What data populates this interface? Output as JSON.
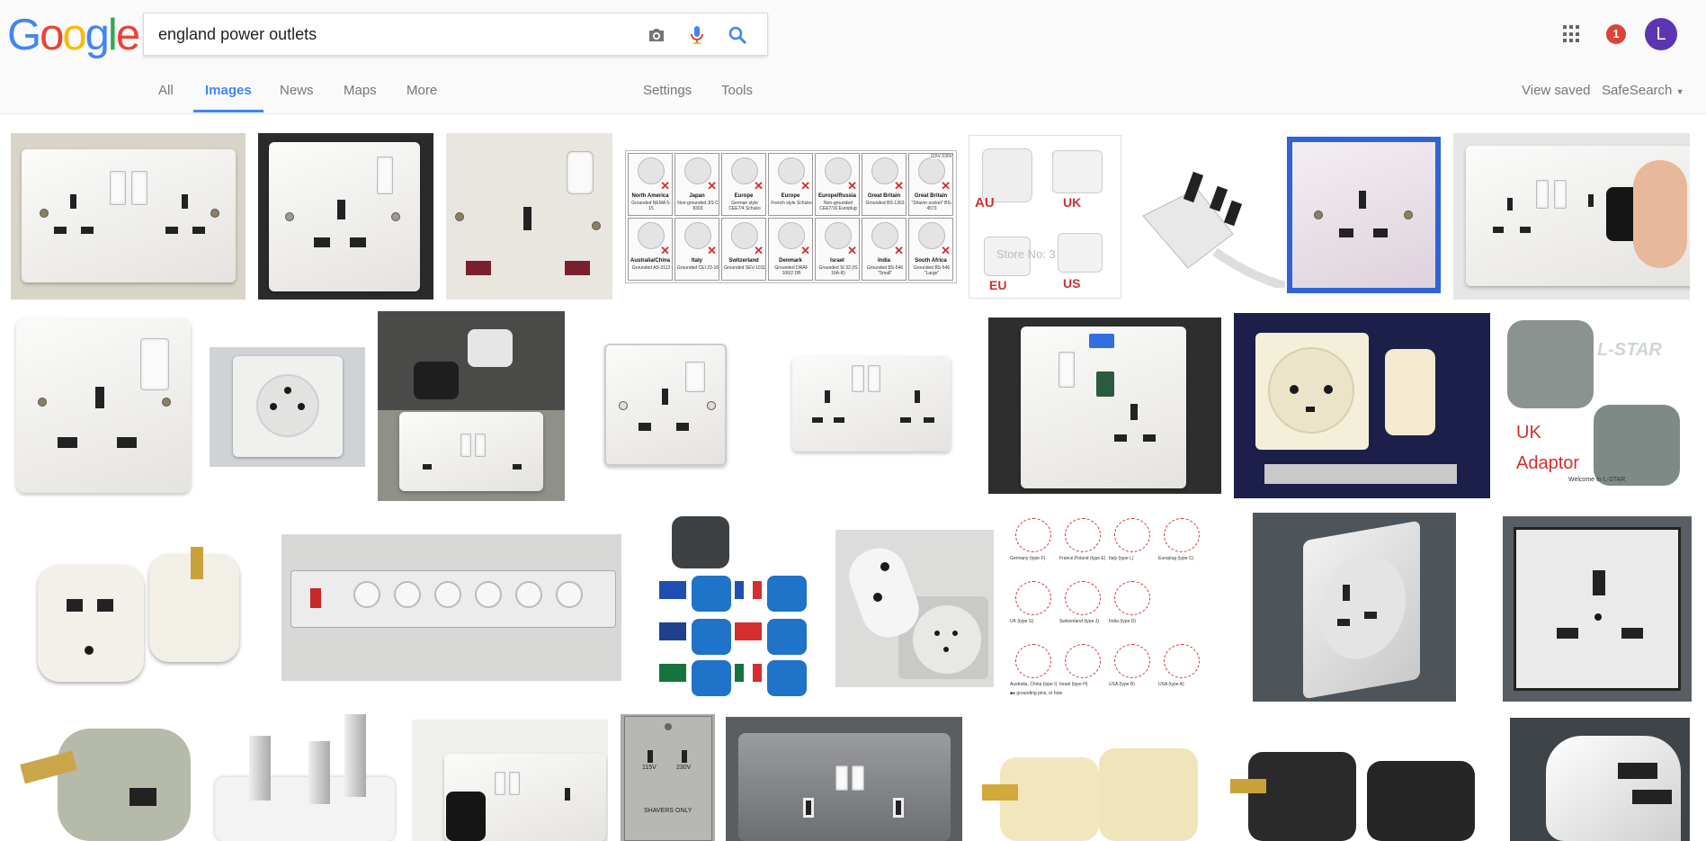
{
  "logo": {
    "letters": [
      "G",
      "o",
      "o",
      "g",
      "l",
      "e"
    ],
    "colors": [
      "#4285f4",
      "#ea4335",
      "#fbbc05",
      "#4285f4",
      "#34a853",
      "#ea4335"
    ]
  },
  "search": {
    "query": "england power outlets",
    "placeholder": ""
  },
  "icons": {
    "camera": "camera-icon",
    "mic": "microphone-icon",
    "search": "search-icon",
    "apps": "apps-grid-icon"
  },
  "tabs": {
    "all": "All",
    "images": "Images",
    "news": "News",
    "maps": "Maps",
    "more": "More",
    "settings": "Settings",
    "tools": "Tools"
  },
  "right": {
    "view_saved": "View saved",
    "safesearch": "SafeSearch",
    "notifications": "1",
    "avatar_letter": "L"
  },
  "colors": {
    "accent": "#4285f4",
    "badge": "#db4437",
    "avatar": "#5e35b1"
  },
  "image_text": {
    "adapter_labels": [
      "AU",
      "UK",
      "EU",
      "US"
    ],
    "adapter_watermark": "Store No: 3",
    "uk_adaptor": [
      "UK",
      "Adaptor"
    ],
    "star_brand": "L-STAR",
    "star_welcome": "Welcome to L-STAR",
    "shaver": [
      "115V",
      "230V",
      "SHAVERS ONLY"
    ],
    "chart_cells": [
      {
        "name": "North America",
        "desc": "Grounded NEMA 5-15"
      },
      {
        "name": "Japan",
        "desc": "Non-grounded JIS C 8303"
      },
      {
        "name": "Europe",
        "desc": "German style CEE7/4 Schuko"
      },
      {
        "name": "Europe",
        "desc": "French style Schuko"
      },
      {
        "name": "Europe/Russia",
        "desc": "Non-grounded CEE7/16 Europlug"
      },
      {
        "name": "Great Britain",
        "desc": "Grounded BS-1363"
      },
      {
        "name": "Great Britain",
        "desc": "\"Shaver socket\" BS-4573"
      },
      {
        "name": "Australia/China",
        "desc": "Grounded AS-3112"
      },
      {
        "name": "Italy",
        "desc": "Grounded CEI 23-16"
      },
      {
        "name": "Switzerland",
        "desc": "Grounded SEV-1011"
      },
      {
        "name": "Denmark",
        "desc": "Grounded DRAF 106/2 DB"
      },
      {
        "name": "Israel",
        "desc": "Grounded SI 32 (IS 16A-R)"
      },
      {
        "name": "India",
        "desc": "Grounded BS-546 \"Small\""
      },
      {
        "name": "South Africa",
        "desc": "Grounded BS-546 \"Large\""
      }
    ],
    "chart_voltage": [
      "115V",
      "230V"
    ],
    "plug_types": [
      "Germany (type F)",
      "France,Poland (type E)",
      "Italy (type L)",
      "Europlug (type C)",
      "UK (type G)",
      "Switzerland (type J)",
      "India (type D)",
      "Australia, China (type I)",
      "Israel (type H)",
      "USA (type B)",
      "USA (type A)",
      "grounding pins, or hole"
    ]
  }
}
